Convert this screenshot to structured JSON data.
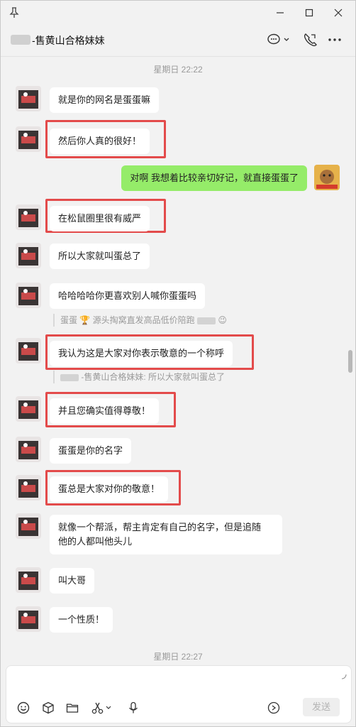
{
  "header": {
    "title": "-售黄山合格妹妹"
  },
  "timestamps": [
    "星期日 22:22",
    "星期日 22:27"
  ],
  "messages": [
    {
      "text": "就是你的网名是蛋蛋嘛"
    },
    {
      "text": "然后你人真的很好！"
    },
    {
      "text": "对啊 我想着比较亲切好记，就直接蛋蛋了"
    },
    {
      "text": "在松鼠圈里很有威严"
    },
    {
      "text": "所以大家就叫蛋总了"
    },
    {
      "text": "哈哈哈哈你更喜欢别人喊你蛋蛋吗"
    },
    {
      "text": "我认为这是大家对你表示敬意的一个称呼"
    },
    {
      "text": "并且您确实值得尊敬！"
    },
    {
      "text": "蛋蛋是你的名字"
    },
    {
      "text": "蛋总是大家对你的敬意！"
    },
    {
      "line1": "就像一个帮派，帮主肯定有自己的名字，但是追随",
      "line2": "他的人都叫他头儿"
    },
    {
      "text": "叫大哥"
    },
    {
      "text": "一个性质！"
    }
  ],
  "quotes": [
    {
      "prefix": "蛋蛋",
      "rest": "源头掏窝直发高品低价陪跑"
    },
    {
      "text": "-售黄山合格妹妹: 所以大家就叫蛋总了"
    }
  ],
  "input": {
    "send_label": "发送"
  },
  "icons": [
    "pin-icon",
    "minimize-icon",
    "maximize-icon",
    "close-icon",
    "chat-icon",
    "phone-icon",
    "more-icon",
    "emoji-icon",
    "package-icon",
    "folder-icon",
    "scissors-icon",
    "microphone-icon",
    "voice-assistant-icon"
  ],
  "colors": {
    "mine_bubble": "#95ec69",
    "highlight": "#e34b4b",
    "background": "#f2f2f2"
  }
}
